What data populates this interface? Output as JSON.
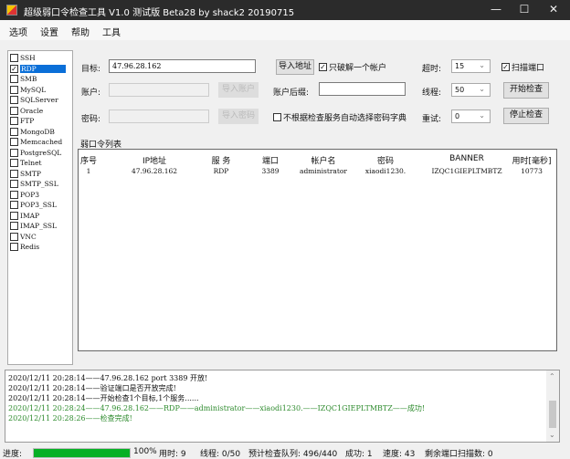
{
  "window": {
    "title": "超级弱口令检查工具 V1.0 测试版 Beta28 by shack2 20190715"
  },
  "menu": [
    "选项",
    "设置",
    "帮助",
    "工具"
  ],
  "services": [
    {
      "label": "SSH",
      "checked": false
    },
    {
      "label": "RDP",
      "checked": true,
      "selected": true
    },
    {
      "label": "SMB",
      "checked": false
    },
    {
      "label": "MySQL",
      "checked": false
    },
    {
      "label": "SQLServer",
      "checked": false
    },
    {
      "label": "Oracle",
      "checked": false
    },
    {
      "label": "FTP",
      "checked": false
    },
    {
      "label": "MongoDB",
      "checked": false
    },
    {
      "label": "Memcached",
      "checked": false
    },
    {
      "label": "PostgreSQL",
      "checked": false
    },
    {
      "label": "Telnet",
      "checked": false
    },
    {
      "label": "SMTP",
      "checked": false
    },
    {
      "label": "SMTP_SSL",
      "checked": false
    },
    {
      "label": "POP3",
      "checked": false
    },
    {
      "label": "POP3_SSL",
      "checked": false
    },
    {
      "label": "IMAP",
      "checked": false
    },
    {
      "label": "IMAP_SSL",
      "checked": false
    },
    {
      "label": "VNC",
      "checked": false
    },
    {
      "label": "Redis",
      "checked": false
    }
  ],
  "form": {
    "target_label": "目标:",
    "target_value": "47.96.28.162",
    "import_address": "导入地址",
    "only_one_account": "只破解一个帐户",
    "only_one_checked": true,
    "timeout_label": "超时:",
    "timeout_value": "15",
    "scan_port": "扫描端口",
    "scan_port_checked": true,
    "account_label": "账户:",
    "import_account": "导入账户",
    "suffix_label": "账户后缀:",
    "suffix_value": "",
    "threads_label": "线程:",
    "threads_value": "50",
    "start": "开始检查",
    "password_label": "密码:",
    "import_password": "导入密码",
    "no_auto_dict": "不根据检查服务自动选择密码字典",
    "no_auto_dict_checked": false,
    "retry_label": "重试:",
    "retry_value": "0",
    "stop": "停止检查"
  },
  "table": {
    "title": "弱口令列表",
    "headers": [
      "序号",
      "IP地址",
      "服 务",
      "端口",
      "帐户名",
      "密码",
      "BANNER",
      "用时[毫秒]"
    ],
    "rows": [
      [
        "1",
        "47.96.28.162",
        "RDP",
        "3389",
        "administrator",
        "xiaodi1230.",
        "IZQC1GIEPLTMBTZ",
        "10773"
      ]
    ]
  },
  "log": [
    {
      "text": "2020/12/11 20:28:14——47.96.28.162 port 3389 开放!",
      "color": "#111111"
    },
    {
      "text": "2020/12/11 20:28:14——验证端口是否开放完成!",
      "color": "#111111"
    },
    {
      "text": "2020/12/11 20:28:14——开始检查1个目标,1个服务......",
      "color": "#111111"
    },
    {
      "text": "2020/12/11 20:28:24——47.96.28.162——RDP——administrator——xiaodi1230.——IZQC1GIEPLTMBTZ——成功!",
      "color": "#2e8b2e"
    },
    {
      "text": "2020/12/11 20:28:26——检查完成!",
      "color": "#2e8b2e"
    }
  ],
  "status": {
    "progress_label": "进度:",
    "progress": 100,
    "progress_text": "100%",
    "elapsed": "用时: 9",
    "threads": "线程: 0/50",
    "queue": "预计检查队列: 496/440",
    "success": "成功: 1",
    "speed": "速度: 43",
    "remaining": "剩余端口扫描数: 0"
  }
}
